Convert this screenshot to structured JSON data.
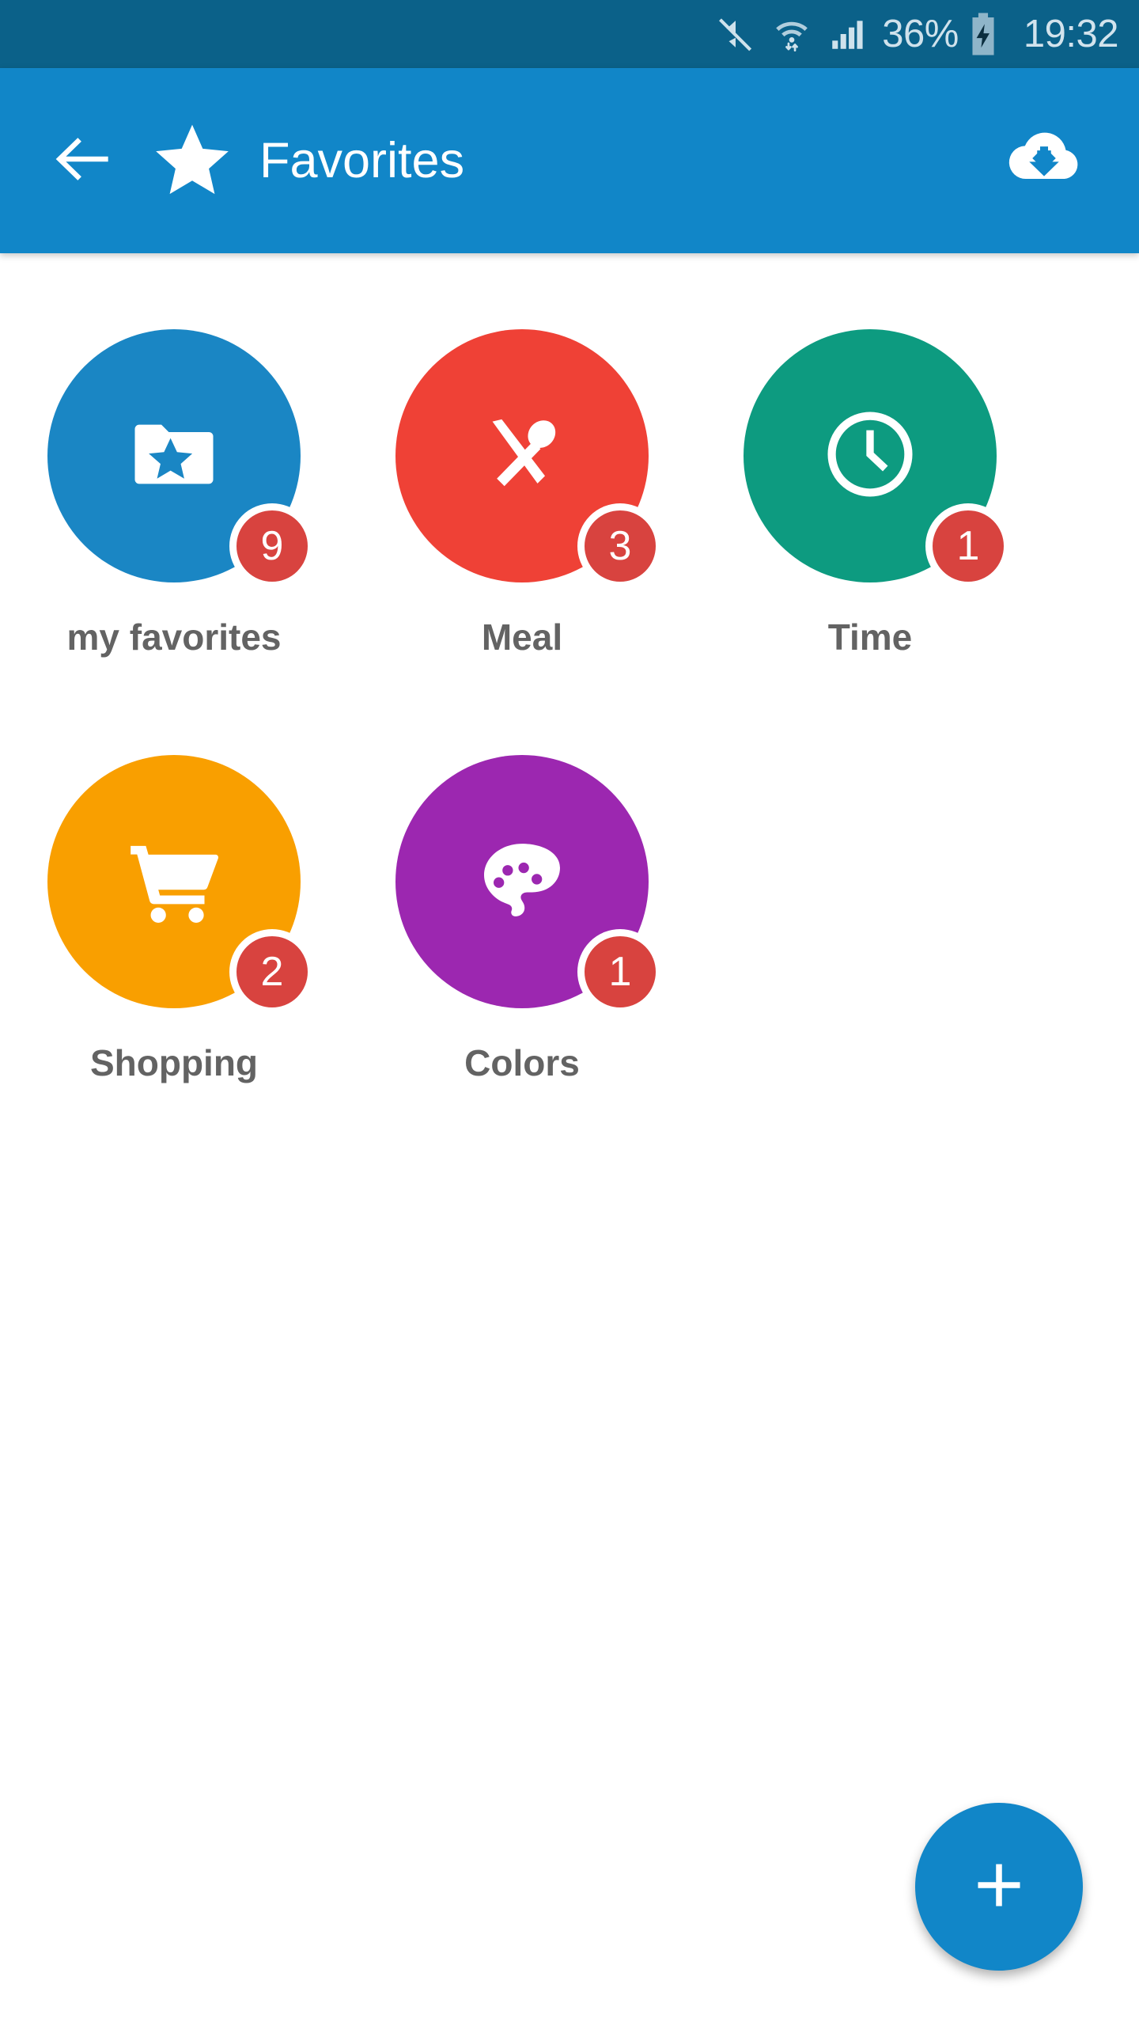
{
  "status_bar": {
    "background_color": "#0b6189",
    "text_color": "#cfe2ec",
    "mute_icon": "mute-icon",
    "wifi_icon": "wifi-transfer-icon",
    "signal_icon": "signal-bars-icon",
    "battery_percent": "36%",
    "battery_icon": "battery-charging-icon",
    "time": "19:32"
  },
  "app_bar": {
    "background_color": "#1186c8",
    "back_icon": "arrow-left-icon",
    "star_icon": "star-icon",
    "title": "Favorites",
    "download_icon": "cloud-download-icon"
  },
  "tiles": [
    {
      "label": "my favorites",
      "badge": "9",
      "color": "#1a86c4",
      "icon": "folder-star-icon"
    },
    {
      "label": "Meal",
      "badge": "3",
      "color": "#ef4136",
      "icon": "cutlery-icon"
    },
    {
      "label": "Time",
      "badge": "1",
      "color": "#0d9b80",
      "icon": "clock-icon"
    },
    {
      "label": "Shopping",
      "badge": "2",
      "color": "#f99f00",
      "icon": "shopping-cart-icon"
    },
    {
      "label": "Colors",
      "badge": "1",
      "color": "#9c27b0",
      "icon": "palette-icon"
    }
  ],
  "badge_color": "#d8433f",
  "label_color": "#636363",
  "fab": {
    "icon": "plus-icon",
    "color": "#1186c8"
  }
}
